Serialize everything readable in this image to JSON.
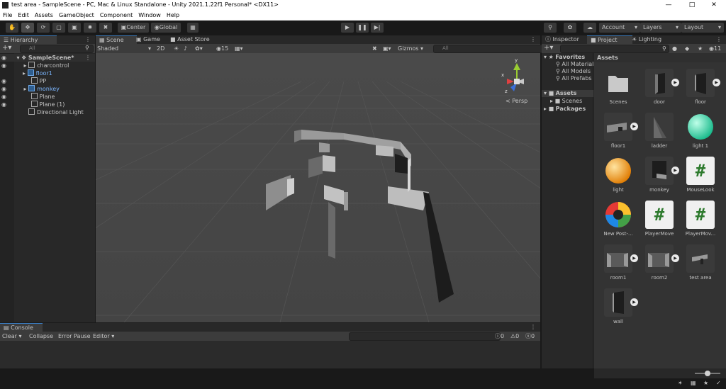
{
  "window": {
    "title": "test area - SampleScene - PC, Mac & Linux Standalone - Unity 2021.1.22f1 Personal* <DX11>",
    "minimize_icon": "minimize-icon",
    "maximize_icon": "maximize-icon",
    "close_icon": "close-icon"
  },
  "menu": [
    "File",
    "Edit",
    "Assets",
    "GameObject",
    "Component",
    "Window",
    "Help"
  ],
  "toolbar": {
    "center_label": "Center",
    "global_label": "Global",
    "account_label": "Account",
    "layers_label": "Layers",
    "layout_label": "Layout"
  },
  "hierarchy": {
    "tab_label": "Hierarchy",
    "search_placeholder": "All",
    "scene_name": "SampleScene*",
    "items": [
      {
        "label": "charcontrol",
        "highlight": false,
        "has_children": true
      },
      {
        "label": "floor1",
        "highlight": true,
        "has_children": true
      },
      {
        "label": "PP",
        "highlight": false,
        "has_children": false
      },
      {
        "label": "monkey",
        "highlight": true,
        "has_children": true
      },
      {
        "label": "Plane",
        "highlight": false,
        "has_children": false
      },
      {
        "label": "Plane (1)",
        "highlight": false,
        "has_children": false
      },
      {
        "label": "Directional Light",
        "highlight": false,
        "has_children": false
      }
    ]
  },
  "scene": {
    "tabs": [
      "Scene",
      "Game",
      "Asset Store"
    ],
    "shading": "Shaded",
    "mode_2d": "2D",
    "gizmos_label": "Gizmos",
    "search_placeholder": "All",
    "layers_count": "15",
    "persp_label": "< Persp",
    "axis_x": "x",
    "axis_y": "y",
    "axis_z": "z"
  },
  "right_panel": {
    "tabs": [
      "Inspector",
      "Project",
      "Lighting"
    ],
    "hidden_count": "11",
    "favorites_label": "Favorites",
    "favorites": [
      "All Materials",
      "All Models",
      "All Prefabs"
    ],
    "assets_label": "Assets",
    "asset_folders": [
      "Scenes"
    ],
    "packages_label": "Packages",
    "assets_header": "Assets",
    "assets": [
      {
        "label": "Scenes",
        "kind": "folder"
      },
      {
        "label": "door",
        "kind": "model"
      },
      {
        "label": "floor",
        "kind": "model"
      },
      {
        "label": "floor1",
        "kind": "model"
      },
      {
        "label": "ladder",
        "kind": "mesh"
      },
      {
        "label": "light 1",
        "kind": "material",
        "color": "#39e6b4"
      },
      {
        "label": "light",
        "kind": "material",
        "color": "#f2a019"
      },
      {
        "label": "monkey",
        "kind": "model"
      },
      {
        "label": "MouseLook",
        "kind": "script"
      },
      {
        "label": "New Post-...",
        "kind": "postprocess"
      },
      {
        "label": "PlayerMove",
        "kind": "script"
      },
      {
        "label": "PlayerMov...",
        "kind": "script"
      },
      {
        "label": "room1",
        "kind": "model"
      },
      {
        "label": "room2",
        "kind": "model"
      },
      {
        "label": "test area",
        "kind": "scene"
      },
      {
        "label": "wall",
        "kind": "model"
      }
    ]
  },
  "console": {
    "tab_label": "Console",
    "clear_label": "Clear",
    "collapse_label": "Collapse",
    "error_pause_label": "Error Pause",
    "editor_label": "Editor",
    "info_count": "0",
    "warn_count": "0",
    "error_count": "0"
  }
}
